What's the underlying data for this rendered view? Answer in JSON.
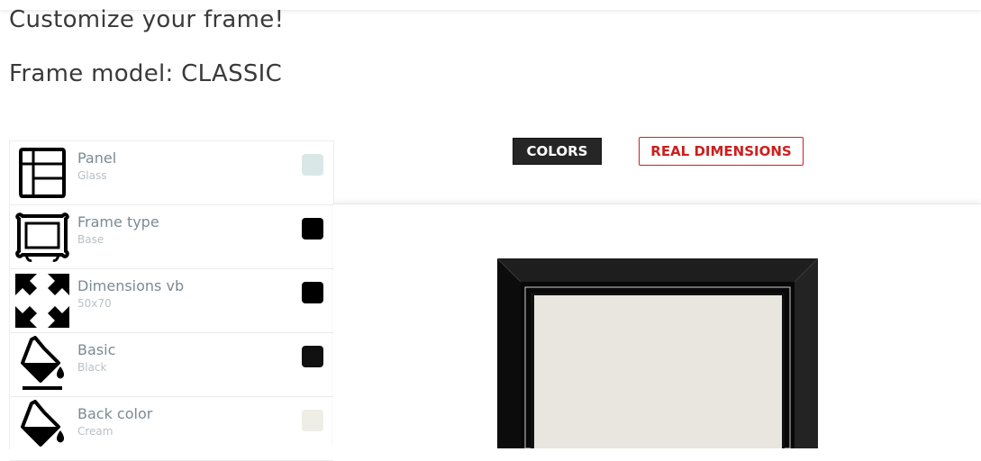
{
  "page": {
    "title": "Customize your frame!",
    "model_line": "Frame model: CLASSIC"
  },
  "options": [
    {
      "name": "Panel",
      "value": "Glass",
      "icon": "panel-grid-icon",
      "swatch_color": "#d9e8e6"
    },
    {
      "name": "Frame type",
      "value": "Base",
      "icon": "ornate-frame-icon",
      "swatch_color": "#000000"
    },
    {
      "name": "Dimensions vb",
      "value": "50x70",
      "icon": "expand-arrows-icon",
      "swatch_color": "#000000"
    },
    {
      "name": "Basic",
      "value": "Black",
      "icon": "paint-bucket-icon",
      "swatch_color": "#111111"
    },
    {
      "name": "Back color",
      "value": "Cream",
      "icon": "paint-bucket-icon",
      "swatch_color": "#eeeee6"
    }
  ],
  "tabs": {
    "colors": "COLORS",
    "real_dimensions": "REAL DIMENSIONS"
  },
  "preview": {
    "frame_color": "#111111",
    "back_color": "#e9e6df"
  }
}
